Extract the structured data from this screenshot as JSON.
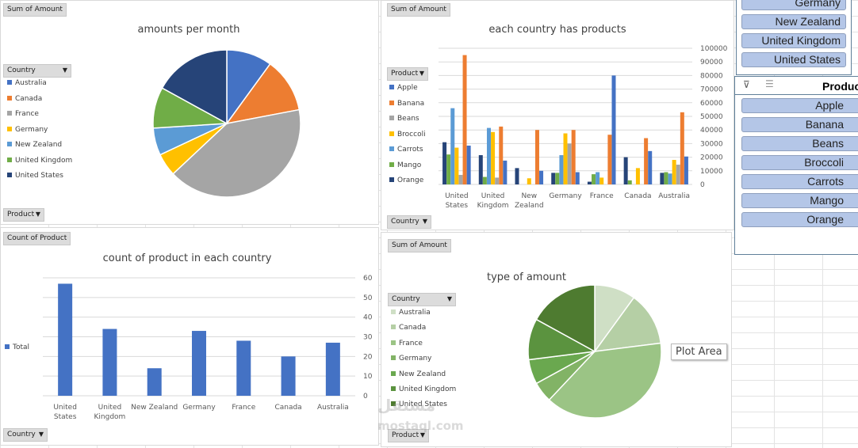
{
  "colors": {
    "apple": "#4472c4",
    "banana": "#ed7d31",
    "beans": "#a5a5a5",
    "broccoli": "#ffc000",
    "carrots": "#5b9bd5",
    "mango": "#70ad47",
    "orange": "#264478",
    "total": "#4472c4"
  },
  "chart_data": [
    {
      "type": "pie",
      "title": "amounts per month",
      "field_button": "Sum of Amount",
      "legend_button": "Country",
      "axis_button": "Product",
      "categories": [
        "Australia",
        "Canada",
        "France",
        "Germany",
        "New Zealand",
        "United Kingdom",
        "United States"
      ],
      "values_pct": [
        10,
        12,
        41,
        5,
        6,
        9,
        17
      ],
      "colors": [
        "#4472c4",
        "#ed7d31",
        "#a5a5a5",
        "#ffc000",
        "#5b9bd5",
        "#70ad47",
        "#264478"
      ]
    },
    {
      "type": "bar",
      "title": "each country has products",
      "field_button": "Sum of Amount",
      "legend_button": "Product",
      "axis_button": "Country",
      "categories": [
        "United States",
        "United Kingdom",
        "New Zealand",
        "Germany",
        "France",
        "Canada",
        "Australia"
      ],
      "category_lines": [
        [
          "United",
          "States"
        ],
        [
          "United",
          "Kingdom"
        ],
        [
          "New",
          "Zealand"
        ],
        [
          "Germany"
        ],
        [
          "France"
        ],
        [
          "Canada"
        ],
        [
          "Australia"
        ]
      ],
      "legend": [
        "Apple",
        "Banana",
        "Beans",
        "Broccoli",
        "Carrots",
        "Mango",
        "Orange"
      ],
      "series": [
        {
          "name": "Orange",
          "color": "#264478",
          "values": [
            31000,
            21500,
            12000,
            8500,
            2000,
            20000,
            8500
          ]
        },
        {
          "name": "Mango",
          "color": "#70ad47",
          "values": [
            22000,
            5500,
            0,
            8500,
            7500,
            3000,
            9000
          ]
        },
        {
          "name": "Carrots",
          "color": "#5b9bd5",
          "values": [
            56000,
            41500,
            0,
            21500,
            9000,
            0,
            8000
          ]
        },
        {
          "name": "Broccoli",
          "color": "#ffc000",
          "values": [
            27000,
            38500,
            4500,
            37500,
            5000,
            12000,
            18000
          ]
        },
        {
          "name": "Beans",
          "color": "#a5a5a5",
          "values": [
            7000,
            5000,
            0,
            30000,
            0,
            0,
            14500
          ]
        },
        {
          "name": "Banana",
          "color": "#ed7d31",
          "values": [
            95000,
            42500,
            40000,
            40000,
            36500,
            34000,
            53000
          ]
        },
        {
          "name": "Apple",
          "color": "#4472c4",
          "values": [
            28500,
            17500,
            10000,
            9000,
            80000,
            24500,
            20500
          ]
        }
      ],
      "yticks": [
        "0",
        "10000",
        "20000",
        "30000",
        "40000",
        "50000",
        "60000",
        "70000",
        "80000",
        "90000",
        "100000"
      ],
      "ylim": [
        0,
        100000
      ],
      "grid": true
    },
    {
      "type": "bar",
      "title": "count of product in each country",
      "field_button": "Count of Product",
      "axis_button": "Country",
      "categories": [
        "United States",
        "United Kingdom",
        "New Zealand",
        "Germany",
        "France",
        "Canada",
        "Australia"
      ],
      "category_lines": [
        [
          "United",
          "States"
        ],
        [
          "United",
          "Kingdom"
        ],
        [
          "New Zealand"
        ],
        [
          "Germany"
        ],
        [
          "France"
        ],
        [
          "Canada"
        ],
        [
          "Australia"
        ]
      ],
      "series": [
        {
          "name": "Total",
          "color": "#4472c4",
          "values": [
            57,
            34,
            14,
            33,
            28,
            20,
            27
          ]
        }
      ],
      "yticks": [
        "0",
        "10",
        "20",
        "30",
        "40",
        "50",
        "60"
      ],
      "ylim": [
        0,
        60
      ],
      "grid": true
    },
    {
      "type": "pie",
      "title": "type of amount",
      "field_button": "Sum of Amount",
      "legend_button": "Country",
      "axis_button": "Product",
      "categories": [
        "Australia",
        "Canada",
        "France",
        "Germany",
        "New Zealand",
        "United Kingdom",
        "United States"
      ],
      "values_pct": [
        10,
        13,
        39,
        5,
        6,
        10,
        17
      ],
      "colors": [
        "#cfdfc5",
        "#b5cfa5",
        "#9bc485",
        "#82b366",
        "#6aa84f",
        "#5b933f",
        "#4e7b30"
      ]
    }
  ],
  "country_slicer": {
    "items": [
      "Germany",
      "New Zealand",
      "United Kingdom",
      "United States"
    ]
  },
  "product_slicer": {
    "title": "Produc",
    "items": [
      "Apple",
      "Banana",
      "Beans",
      "Broccoli",
      "Carrots",
      "Mango",
      "Orange"
    ]
  },
  "tooltip": "Plot Area",
  "watermark": "mostaql.com"
}
